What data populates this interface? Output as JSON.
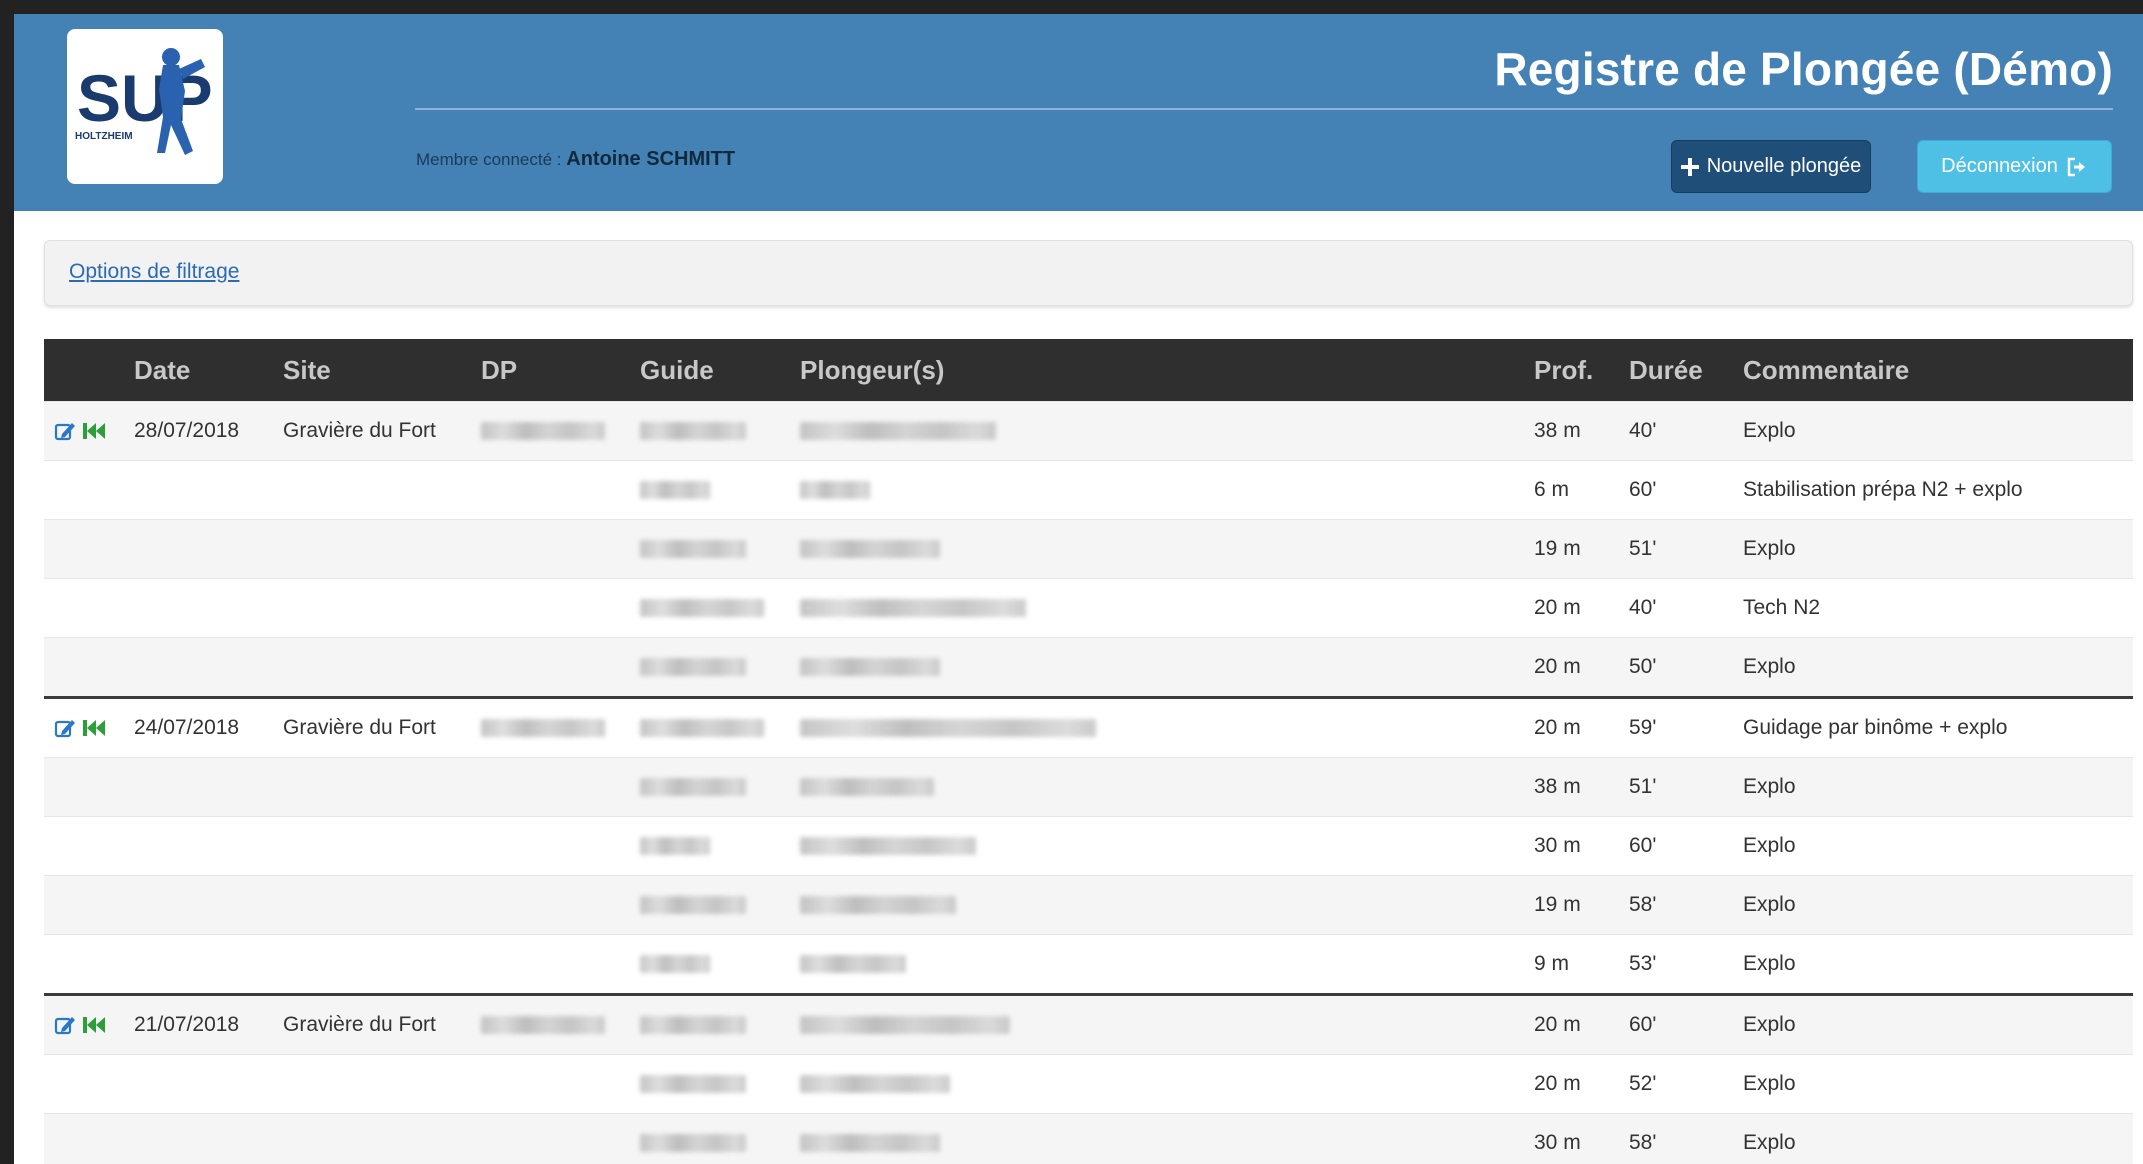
{
  "header": {
    "title": "Registre de Plongée (Démo)",
    "logo_text": "SUP",
    "logo_subtext": "HOLTZHEIM",
    "member_label": "Membre connecté :",
    "member_name": "Antoine SCHMITT",
    "new_dive_label": "Nouvelle plongée",
    "logout_label": "Déconnexion"
  },
  "filter": {
    "label": "Options de filtrage"
  },
  "table": {
    "columns": [
      "Date",
      "Site",
      "DP",
      "Guide",
      "Plongeur(s)",
      "Prof.",
      "Durée",
      "Commentaire"
    ],
    "rows": [
      {
        "date": "28/07/2018",
        "site": "Gravière du Fort",
        "depth": "38 m",
        "duration": "40'",
        "comment": "Explo"
      },
      {
        "date": "",
        "site": "",
        "depth": "6 m",
        "duration": "60'",
        "comment": "Stabilisation prépa N2 + explo"
      },
      {
        "date": "",
        "site": "",
        "depth": "19 m",
        "duration": "51'",
        "comment": "Explo"
      },
      {
        "date": "",
        "site": "",
        "depth": "20 m",
        "duration": "40'",
        "comment": "Tech N2"
      },
      {
        "date": "",
        "site": "",
        "depth": "20 m",
        "duration": "50'",
        "comment": "Explo"
      },
      {
        "date": "24/07/2018",
        "site": "Gravière du Fort",
        "depth": "20 m",
        "duration": "59'",
        "comment": "Guidage par binôme + explo"
      },
      {
        "date": "",
        "site": "",
        "depth": "38 m",
        "duration": "51'",
        "comment": "Explo"
      },
      {
        "date": "",
        "site": "",
        "depth": "30 m",
        "duration": "60'",
        "comment": "Explo"
      },
      {
        "date": "",
        "site": "",
        "depth": "19 m",
        "duration": "58'",
        "comment": "Explo"
      },
      {
        "date": "",
        "site": "",
        "depth": "9 m",
        "duration": "53'",
        "comment": "Explo"
      },
      {
        "date": "21/07/2018",
        "site": "Gravière du Fort",
        "depth": "20 m",
        "duration": "60'",
        "comment": "Explo"
      },
      {
        "date": "",
        "site": "",
        "depth": "20 m",
        "duration": "52'",
        "comment": "Explo"
      },
      {
        "date": "",
        "site": "",
        "depth": "30 m",
        "duration": "58'",
        "comment": "Explo"
      }
    ]
  },
  "icons": {
    "edit": "edit-icon",
    "rewind": "rewind-icon",
    "plus": "plus-icon",
    "logout": "logout-icon"
  },
  "colors": {
    "header_bg": "#4482b5",
    "table_header_bg": "#2f2f2f",
    "new_dive_button": "#1f4e79",
    "logout_button": "#4ec0e6",
    "edit_icon": "#2a78c8",
    "rewind_icon": "#2e9e3a"
  }
}
